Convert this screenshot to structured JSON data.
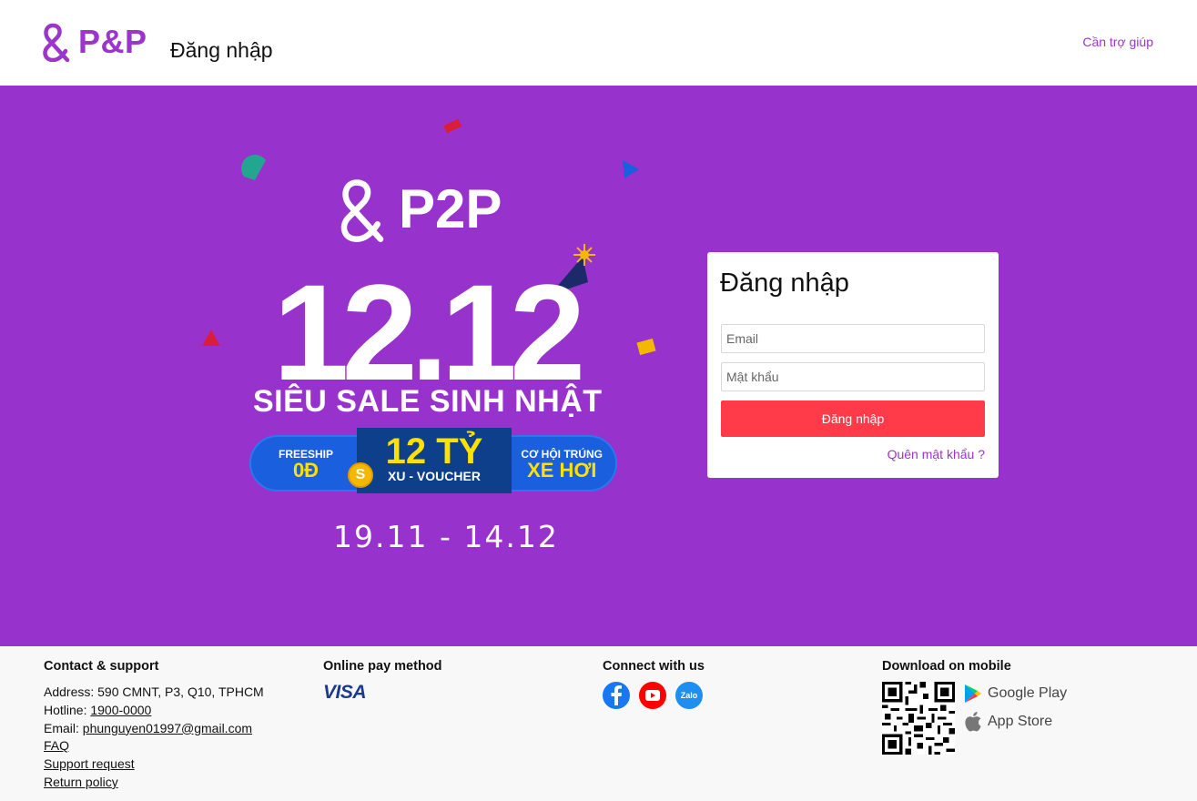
{
  "header": {
    "brand": "P&P",
    "page_title": "Đăng nhập",
    "help_link": "Cần trợ giúp"
  },
  "banner": {
    "brand": "P2P",
    "big_date": "12.12",
    "sale_title": "SIÊU SALE SINH NHẬT",
    "pill": {
      "left_l1": "FREESHIP",
      "left_l2": "0Đ",
      "center_l1": "12 TỶ",
      "center_l2": "XU - VOUCHER",
      "right_l1": "CƠ HỘI TRÚNG",
      "right_l2": "XE HƠI"
    },
    "coin_glyph": "S",
    "date_range": "19.11 - 14.12",
    "background": "#9733cc"
  },
  "login": {
    "heading": "Đăng nhập",
    "email_placeholder": "Email",
    "email_value": "",
    "password_placeholder": "Mật khẩu",
    "password_value": "",
    "submit_label": "Đăng nhập",
    "forgot_link": "Quên mật khẩu ?",
    "button_color": "#ff3b4a"
  },
  "footer": {
    "contact": {
      "title": "Contact & support",
      "address": "Address: 590 CMNT, P3, Q10, TPHCM",
      "hotline_label": "Hotline: ",
      "hotline": "1900-0000",
      "email_label": "Email: ",
      "email": "phunguyen01997@gmail.com",
      "faq": "FAQ",
      "support": "Support request",
      "return_policy": "Return policy"
    },
    "pay": {
      "title": "Online pay method",
      "visa": "VISA"
    },
    "connect": {
      "title": "Connect with us",
      "icons": [
        "facebook-icon",
        "youtube-icon",
        "zalo-icon"
      ],
      "zalo_label": "Zalo"
    },
    "mobile": {
      "title": "Download on mobile",
      "google_play": "Google Play",
      "app_store": "App Store"
    }
  },
  "colors": {
    "brand_purple": "#9b35cc",
    "banner_purple": "#9733cc",
    "login_red": "#ff3b4a"
  }
}
